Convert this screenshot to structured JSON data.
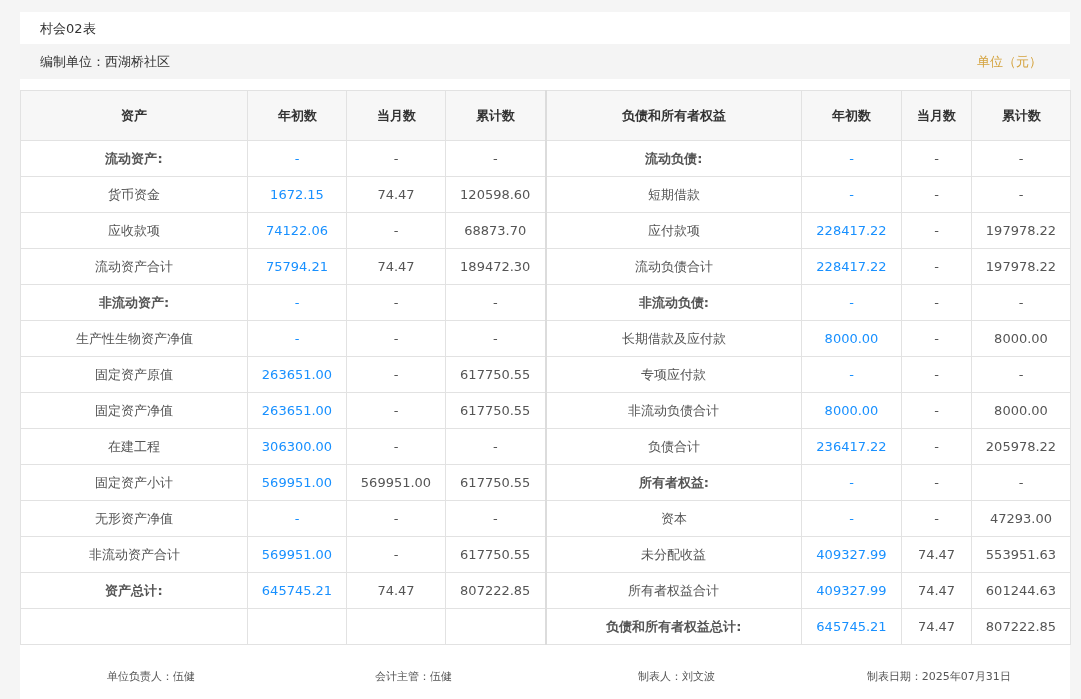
{
  "title": "村会02表",
  "info_bar": {
    "unit_org": "编制单位：西湖桥社区",
    "currency": "单位（元）"
  },
  "columns": {
    "left": [
      "资产",
      "年初数",
      "当月数",
      "累计数"
    ],
    "right": [
      "负债和所有者权益",
      "年初数",
      "当月数",
      "累计数"
    ]
  },
  "rows": [
    {
      "left": {
        "label": "流动资产:",
        "bold": true,
        "values": [
          "-",
          "-",
          "-"
        ]
      },
      "right": {
        "label": "流动负债:",
        "bold": true,
        "values": [
          "-",
          "-",
          "-"
        ]
      }
    },
    {
      "left": {
        "label": "货币资金",
        "bold": false,
        "values": [
          "1672.15",
          "74.47",
          "120598.60"
        ]
      },
      "right": {
        "label": "短期借款",
        "bold": false,
        "values": [
          "-",
          "-",
          "-"
        ]
      }
    },
    {
      "left": {
        "label": "应收款项",
        "bold": false,
        "values": [
          "74122.06",
          "-",
          "68873.70"
        ]
      },
      "right": {
        "label": "应付款项",
        "bold": false,
        "values": [
          "228417.22",
          "-",
          "197978.22"
        ]
      }
    },
    {
      "left": {
        "label": "流动资产合计",
        "bold": false,
        "values": [
          "75794.21",
          "74.47",
          "189472.30"
        ]
      },
      "right": {
        "label": "流动负债合计",
        "bold": false,
        "values": [
          "228417.22",
          "-",
          "197978.22"
        ]
      }
    },
    {
      "left": {
        "label": "非流动资产:",
        "bold": true,
        "values": [
          "-",
          "-",
          "-"
        ]
      },
      "right": {
        "label": "非流动负债:",
        "bold": true,
        "values": [
          "-",
          "-",
          "-"
        ]
      }
    },
    {
      "left": {
        "label": "生产性生物资产净值",
        "bold": false,
        "values": [
          "-",
          "-",
          "-"
        ]
      },
      "right": {
        "label": "长期借款及应付款",
        "bold": false,
        "values": [
          "8000.00",
          "-",
          "8000.00"
        ]
      }
    },
    {
      "left": {
        "label": "固定资产原值",
        "bold": false,
        "values": [
          "263651.00",
          "-",
          "617750.55"
        ]
      },
      "right": {
        "label": "专项应付款",
        "bold": false,
        "values": [
          "-",
          "-",
          "-"
        ]
      }
    },
    {
      "left": {
        "label": "固定资产净值",
        "bold": false,
        "values": [
          "263651.00",
          "-",
          "617750.55"
        ]
      },
      "right": {
        "label": "非流动负债合计",
        "bold": false,
        "values": [
          "8000.00",
          "-",
          "8000.00"
        ]
      }
    },
    {
      "left": {
        "label": "在建工程",
        "bold": false,
        "values": [
          "306300.00",
          "-",
          "-"
        ]
      },
      "right": {
        "label": "负债合计",
        "bold": false,
        "values": [
          "236417.22",
          "-",
          "205978.22"
        ]
      }
    },
    {
      "left": {
        "label": "固定资产小计",
        "bold": false,
        "values": [
          "569951.00",
          "569951.00",
          "617750.55"
        ]
      },
      "right": {
        "label": "所有者权益:",
        "bold": true,
        "values": [
          "-",
          "-",
          "-"
        ]
      }
    },
    {
      "left": {
        "label": "无形资产净值",
        "bold": false,
        "values": [
          "-",
          "-",
          "-"
        ]
      },
      "right": {
        "label": "资本",
        "bold": false,
        "values": [
          "-",
          "-",
          "47293.00"
        ]
      }
    },
    {
      "left": {
        "label": "非流动资产合计",
        "bold": false,
        "values": [
          "569951.00",
          "-",
          "617750.55"
        ]
      },
      "right": {
        "label": "未分配收益",
        "bold": false,
        "values": [
          "409327.99",
          "74.47",
          "553951.63"
        ]
      }
    },
    {
      "left": {
        "label": "资产总计:",
        "bold": true,
        "values": [
          "645745.21",
          "74.47",
          "807222.85"
        ]
      },
      "right": {
        "label": "所有者权益合计",
        "bold": false,
        "values": [
          "409327.99",
          "74.47",
          "601244.63"
        ]
      }
    },
    {
      "left": null,
      "right": {
        "label": "负债和所有者权益总计:",
        "bold": true,
        "values": [
          "645745.21",
          "74.47",
          "807222.85"
        ]
      }
    }
  ],
  "footer": [
    "单位负责人：伍健",
    "会计主管：伍健",
    "制表人：刘文波",
    "制表日期：2025年07月31日"
  ]
}
